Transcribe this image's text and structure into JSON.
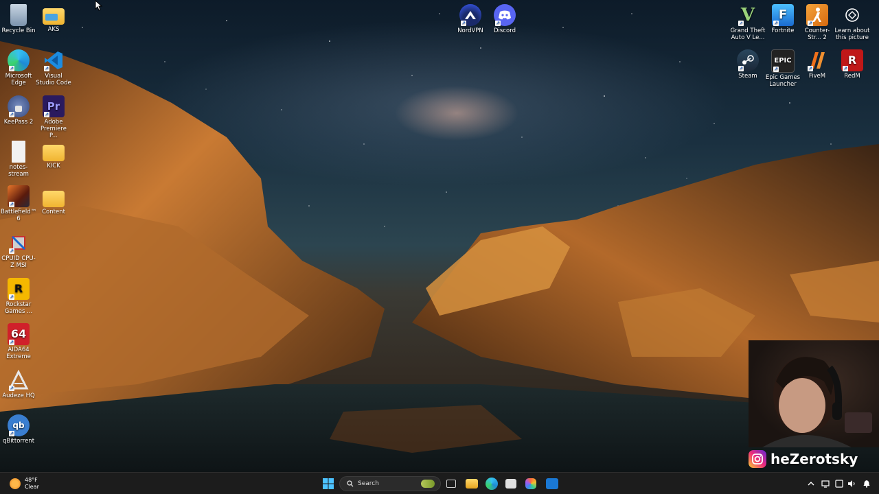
{
  "desktop": {
    "left_icons": [
      {
        "label": "Recycle Bin",
        "icon": "recycle-bin-icon",
        "color": "#8aa4c0"
      },
      {
        "label": "AKS",
        "icon": "folder-icon",
        "color": "#f4c94f"
      },
      {
        "label": "Microsoft Edge",
        "icon": "edge-icon",
        "color": "#1f8fd6"
      },
      {
        "label": "Visual Studio Code",
        "icon": "vscode-icon",
        "color": "#1c8ce0"
      },
      {
        "label": "KeePass 2",
        "icon": "keepass-icon",
        "color": "#4a6fb5"
      },
      {
        "label": "Adobe Premiere P...",
        "icon": "premiere-icon",
        "color": "#2a1a5e"
      },
      {
        "label": "notes-stream",
        "icon": "text-file-icon",
        "color": "#f2f2f2"
      },
      {
        "label": "KICK",
        "icon": "folder-icon",
        "color": "#f4c94f"
      },
      {
        "label": "Battlefield™ 6",
        "icon": "battlefield-icon",
        "color": "#a33a1a"
      },
      {
        "label": "Content",
        "icon": "folder-icon",
        "color": "#f4c94f"
      },
      {
        "label": "CPUID CPU-Z MSI",
        "icon": "cpuz-icon",
        "color": "#c83030"
      },
      {
        "label": "Rockstar Games ...",
        "icon": "rockstar-icon",
        "color": "#f5b800"
      },
      {
        "label": "AIDA64 Extreme",
        "icon": "aida64-icon",
        "color": "#d0202a"
      },
      {
        "label": "Audeze HQ",
        "icon": "audeze-icon",
        "color": "#202020"
      },
      {
        "label": "qBittorrent",
        "icon": "qbittorrent-icon",
        "color": "#3a7ed0"
      }
    ],
    "top_center_icons": [
      {
        "label": "NordVPN",
        "icon": "nordvpn-icon",
        "color": "#3e5fff"
      },
      {
        "label": "Discord",
        "icon": "discord-icon",
        "color": "#5865f2"
      }
    ],
    "right_icons": [
      {
        "label": "Grand Theft Auto V Le...",
        "icon": "gta-icon",
        "color": "#2d6a2d"
      },
      {
        "label": "Fortnite",
        "icon": "fortnite-icon",
        "color": "#2b8ce8"
      },
      {
        "label": "Counter-Str... 2",
        "icon": "cs2-icon",
        "color": "#e8902a"
      },
      {
        "label": "Learn about this picture",
        "icon": "learn-picture-icon",
        "color": "#ffffff"
      },
      {
        "label": "Steam",
        "icon": "steam-icon",
        "color": "#1b2838"
      },
      {
        "label": "Epic Games Launcher",
        "icon": "epic-games-icon",
        "color": "#222222"
      },
      {
        "label": "FiveM",
        "icon": "fivem-icon",
        "color": "#f0701a"
      },
      {
        "label": "RedM",
        "icon": "redm-icon",
        "color": "#c01818"
      }
    ]
  },
  "taskbar": {
    "weather_temp": "48°F",
    "weather_condition": "Clear",
    "search_placeholder": "Search",
    "apps": [
      {
        "icon": "task-view-icon",
        "color": "#cfcfcf"
      },
      {
        "icon": "file-explorer-icon",
        "color": "#f4c94f"
      },
      {
        "icon": "edge-icon",
        "color": "#1f8fd6"
      },
      {
        "icon": "microsoft-store-icon",
        "color": "#e0e0e0"
      },
      {
        "icon": "copilot-icon",
        "color": "#7a5cf0"
      },
      {
        "icon": "outlook-icon",
        "color": "#1a78d4"
      }
    ]
  },
  "overlay": {
    "instagram_handle": "heZerotsky"
  }
}
